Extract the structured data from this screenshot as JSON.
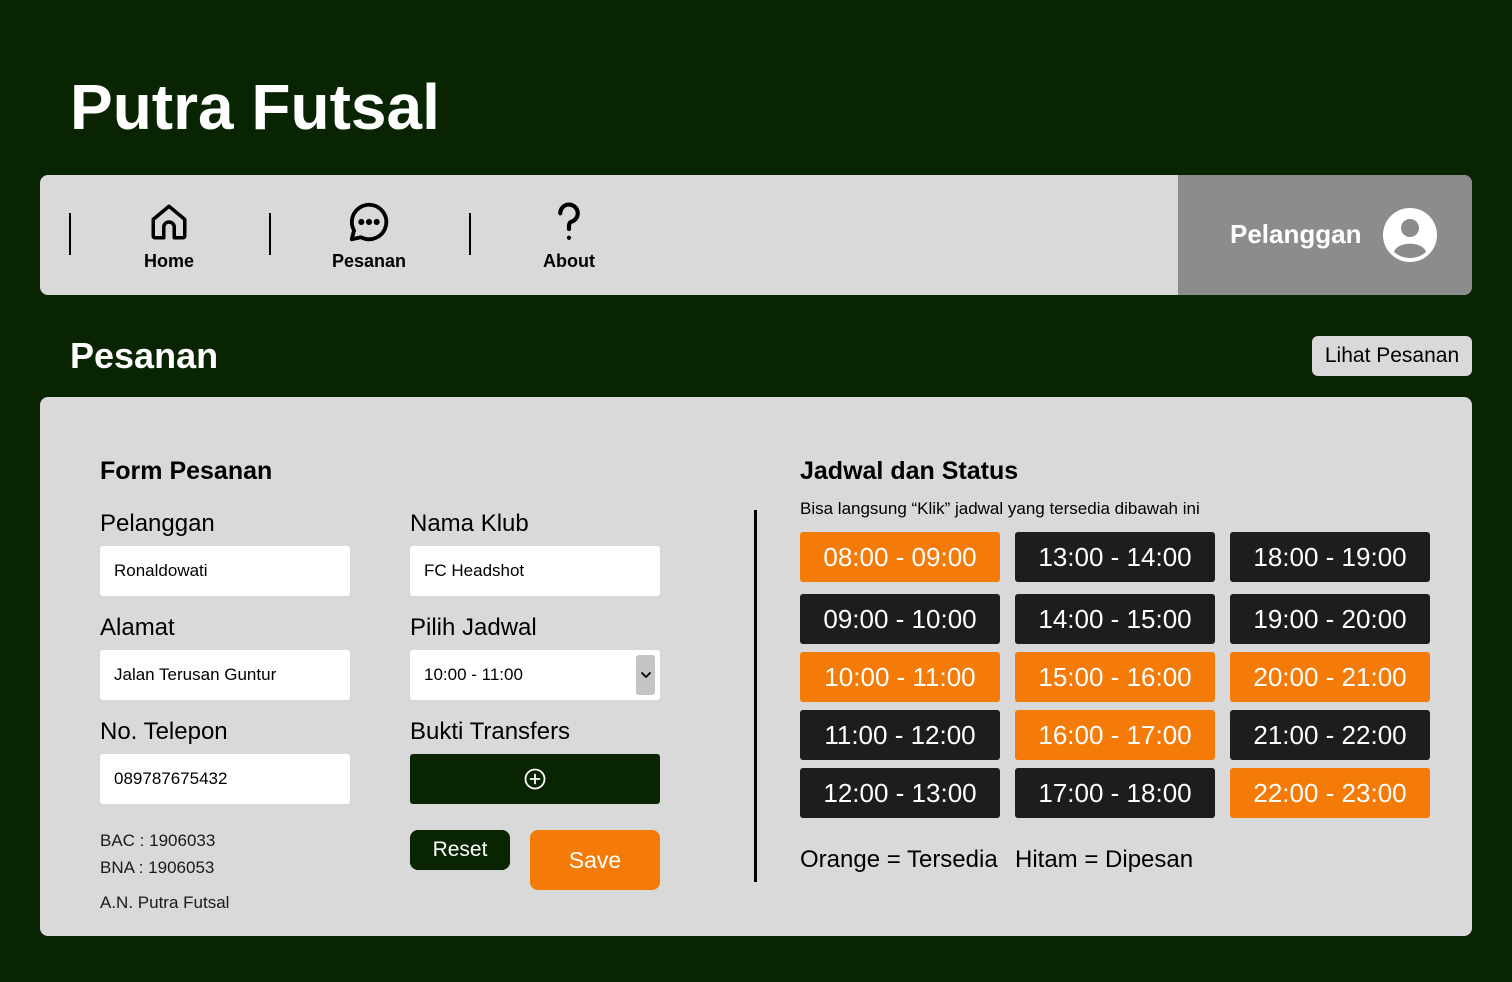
{
  "app": {
    "title": "Putra Futsal"
  },
  "nav": {
    "items": [
      {
        "label": "Home",
        "icon": "home-icon"
      },
      {
        "label": "Pesanan",
        "icon": "chat-icon"
      },
      {
        "label": "About",
        "icon": "question-icon"
      }
    ],
    "user": {
      "name": "Pelanggan",
      "icon": "user-avatar-icon"
    }
  },
  "section": {
    "title": "Pesanan",
    "lihat_button": "Lihat Pesanan"
  },
  "form": {
    "title": "Form Pesanan",
    "pelanggan": {
      "label": "Pelanggan",
      "value": "Ronaldowati"
    },
    "nama_klub": {
      "label": "Nama Klub",
      "value": "FC Headshot"
    },
    "alamat": {
      "label": "Alamat",
      "value": "Jalan Terusan Guntur"
    },
    "jadwal": {
      "label": "Pilih Jadwal",
      "value": "10:00 - 11:00"
    },
    "telepon": {
      "label": "No. Telepon",
      "value": "089787675432"
    },
    "bukti": {
      "label": "Bukti Transfers",
      "icon": "add-circle-icon"
    },
    "bank": {
      "bac": "BAC : 1906033",
      "bna": "BNA : 1906053",
      "an": "A.N. Putra Futsal"
    },
    "reset_button": "Reset",
    "save_button": "Save"
  },
  "schedule": {
    "title": "Jadwal dan Status",
    "subtitle": "Bisa langsung “Klik” jadwal yang tersedia dibawah ini",
    "columns": [
      [
        {
          "time": "08:00 - 09:00",
          "status": "available"
        },
        {
          "time": "09:00 - 10:00",
          "status": "booked"
        },
        {
          "time": "10:00 - 11:00",
          "status": "available"
        },
        {
          "time": "11:00 - 12:00",
          "status": "booked"
        },
        {
          "time": "12:00 - 13:00",
          "status": "booked"
        }
      ],
      [
        {
          "time": "13:00 - 14:00",
          "status": "booked"
        },
        {
          "time": "14:00 - 15:00",
          "status": "booked"
        },
        {
          "time": "15:00 - 16:00",
          "status": "available"
        },
        {
          "time": "16:00 - 17:00",
          "status": "available"
        },
        {
          "time": "17:00 - 18:00",
          "status": "booked"
        }
      ],
      [
        {
          "time": "18:00 - 19:00",
          "status": "booked"
        },
        {
          "time": "19:00 - 20:00",
          "status": "booked"
        },
        {
          "time": "20:00 - 21:00",
          "status": "available"
        },
        {
          "time": "21:00 - 22:00",
          "status": "booked"
        },
        {
          "time": "22:00 - 23:00",
          "status": "available"
        }
      ]
    ],
    "legend": {
      "orange": "Orange = Tersedia",
      "black": "Hitam = Dipesan"
    }
  },
  "colors": {
    "background": "#082400",
    "panel": "#d9d9d9",
    "user_panel": "#8c8c8c",
    "available": "#f47b07",
    "booked": "#1d1d1d"
  }
}
